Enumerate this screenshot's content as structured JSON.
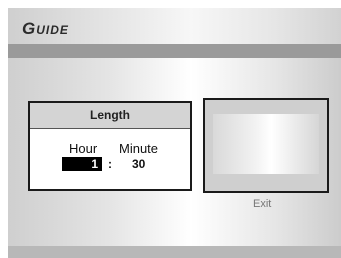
{
  "header": {
    "title": "Guide"
  },
  "length_panel": {
    "title": "Length",
    "hour_label": "Hour",
    "minute_label": "Minute",
    "hour_value": "1",
    "separator": ":",
    "minute_value": "30"
  },
  "preview": {
    "exit_label": "Exit"
  }
}
